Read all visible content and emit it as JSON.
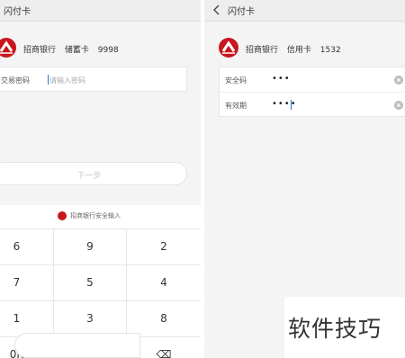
{
  "left_screen": {
    "title": "闪付卡",
    "card": {
      "bank": "招商银行",
      "card_type": "储蓄卡",
      "last4": "9998"
    },
    "password_label": "交易密码",
    "password_placeholder": "请输入密码",
    "next_button_label": "下一步",
    "keyboard": {
      "header_text": "招商银行安全输入",
      "rows": [
        [
          "6",
          "9",
          "2"
        ],
        [
          "7",
          "5",
          "4"
        ],
        [
          "1",
          "3",
          "8"
        ],
        [
          "0K",
          "0",
          "⌫"
        ]
      ]
    }
  },
  "right_screen": {
    "title": "闪付卡",
    "card": {
      "bank": "招商银行",
      "card_type": "信用卡",
      "last4": "1532"
    },
    "fields": [
      {
        "label": "安全码",
        "value": "•••"
      },
      {
        "label": "有效期",
        "value": "••••"
      }
    ]
  },
  "watermark": "软件技巧",
  "colors": {
    "brand_red": "#c8161d",
    "cursor_blue": "#1e7fe0"
  }
}
